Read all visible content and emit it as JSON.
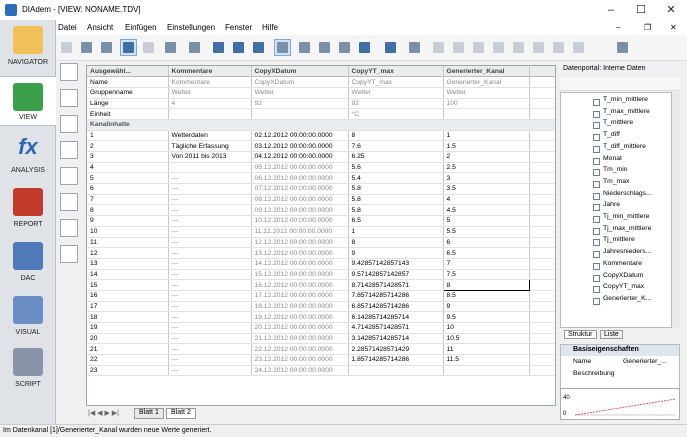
{
  "window": {
    "title": "DIAdem - [VIEW:  NONAME.TDV]"
  },
  "menu": [
    "Datei",
    "Ansicht",
    "Einfügen",
    "Einstellungen",
    "Fenster",
    "Hilfe"
  ],
  "nav": [
    {
      "label": "NAVIGATOR",
      "icon": "navigator-icon"
    },
    {
      "label": "VIEW",
      "icon": "view-icon"
    },
    {
      "label": "ANALYSIS",
      "icon": "analysis-icon"
    },
    {
      "label": "REPORT",
      "icon": "report-icon"
    },
    {
      "label": "DAC",
      "icon": "dac-icon"
    },
    {
      "label": "VISUAL",
      "icon": "visual-icon"
    },
    {
      "label": "SCRIPT",
      "icon": "script-icon"
    }
  ],
  "grid": {
    "area_label": "Ausgewähl...",
    "columns": [
      "Kommentare",
      "CopyXDatum",
      "CopyYT_max",
      "Generierter_Kanal"
    ],
    "props": [
      {
        "label": "Name",
        "values": [
          "Kommentare",
          "CopyXDatum",
          "CopyYT_max",
          "Generierter_Kanal"
        ]
      },
      {
        "label": "Gruppenname",
        "values": [
          "Wetter",
          "Wetter",
          "Wetter",
          "Wetter"
        ]
      },
      {
        "label": "Länge",
        "values": [
          "4",
          "92",
          "92",
          "100"
        ]
      },
      {
        "label": "Einheit",
        "values": [
          "",
          "",
          "°C",
          ""
        ]
      }
    ],
    "section": "Kanalinhalte",
    "rows": [
      [
        "1",
        "Wetterdaten",
        "02.12.2012 00:00:00.0000",
        "8",
        "1"
      ],
      [
        "2",
        "Tägliche Erfassung",
        "03.12.2012 00:00:00.0000",
        "7.6",
        "1.5"
      ],
      [
        "3",
        "Von 2011 bis 2013",
        "04.12.2012 00:00:00.0000",
        "6.25",
        "2"
      ],
      [
        "4",
        "",
        "05.12.2012 00:00:00.0000",
        "5.6",
        "2.5"
      ],
      [
        "5",
        "---",
        "06.12.2012 00:00:00.0000",
        "5.4",
        "3"
      ],
      [
        "6",
        "---",
        "07.12.2012 00:00:00.0000",
        "5.8",
        "3.5"
      ],
      [
        "7",
        "---",
        "08.12.2012 00:00:00.0000",
        "5.8",
        "4"
      ],
      [
        "8",
        "---",
        "09.12.2012 00:00:00.0000",
        "5.8",
        "4.5"
      ],
      [
        "9",
        "---",
        "10.12.2012 00:00:00.0000",
        "6.5",
        "5"
      ],
      [
        "10",
        "---",
        "11.12.2012 00:00:00.0000",
        "1",
        "5.5"
      ],
      [
        "11",
        "---",
        "12.12.2012 00:00:00.0000",
        "8",
        "6"
      ],
      [
        "12",
        "---",
        "13.12.2012 00:00:00.0000",
        "9",
        "6.5"
      ],
      [
        "13",
        "---",
        "14.12.2012 00:00:00.0000",
        "9.42857142857143",
        "7"
      ],
      [
        "14",
        "---",
        "15.12.2012 00:00:00.0000",
        "9.57142857142857",
        "7.5"
      ],
      [
        "15",
        "---",
        "16.12.2012 00:00:00.0000",
        "8.71428571428571",
        "8"
      ],
      [
        "16",
        "---",
        "17.12.2012 00:00:00.0000",
        "7.85714285714286",
        "8.5"
      ],
      [
        "17",
        "---",
        "18.12.2012 00:00:00.0000",
        "6.85714285714286",
        "9"
      ],
      [
        "18",
        "---",
        "19.12.2012 00:00:00.0000",
        "6.14285714285714",
        "9.5"
      ],
      [
        "19",
        "---",
        "20.12.2012 00:00:00.0000",
        "4.71428571428571",
        "10"
      ],
      [
        "20",
        "---",
        "21.12.2012 00:00:00.0000",
        "3.14285714285714",
        "10.5"
      ],
      [
        "21",
        "---",
        "22.12.2012 00:00:00.0000",
        "2.28571428571429",
        "11"
      ],
      [
        "22",
        "---",
        "23.12.2012 00:00:00.0000",
        "1.85714285714286",
        "11.5"
      ],
      [
        "23",
        "---",
        "24.12.2012 00:00:00.0000",
        "",
        ""
      ]
    ]
  },
  "sheets": [
    "Blatt 1",
    "Blatt 2"
  ],
  "status": "Im Datenkanal [1]/Generierter_Kanal wurden neue Werte generiert.",
  "portal": {
    "title": "Datenportal: Interne Daten",
    "items": [
      "T_min_mittlere",
      "T_max_mittlere",
      "T_mittlere",
      "T_diff",
      "T_diff_mittlere",
      "Monat",
      "Tm_min",
      "Tm_max",
      "Niederschlags...",
      "Jahre",
      "Tj_min_mittlere",
      "Tj_max_mittlere",
      "Tj_mittlere",
      "Jahresnieders...",
      "Kommentare",
      "CopyXDatum",
      "CopyYT_max",
      "Generierter_K..."
    ],
    "tabs": [
      "Struktur",
      "Liste"
    ]
  },
  "basis": {
    "title": "Basiseigenschaften",
    "name_label": "Name",
    "name_value": "Generierter_...",
    "desc_label": "Beschreibung"
  },
  "miniplot": {
    "y_ticks": [
      "40",
      "0"
    ]
  }
}
